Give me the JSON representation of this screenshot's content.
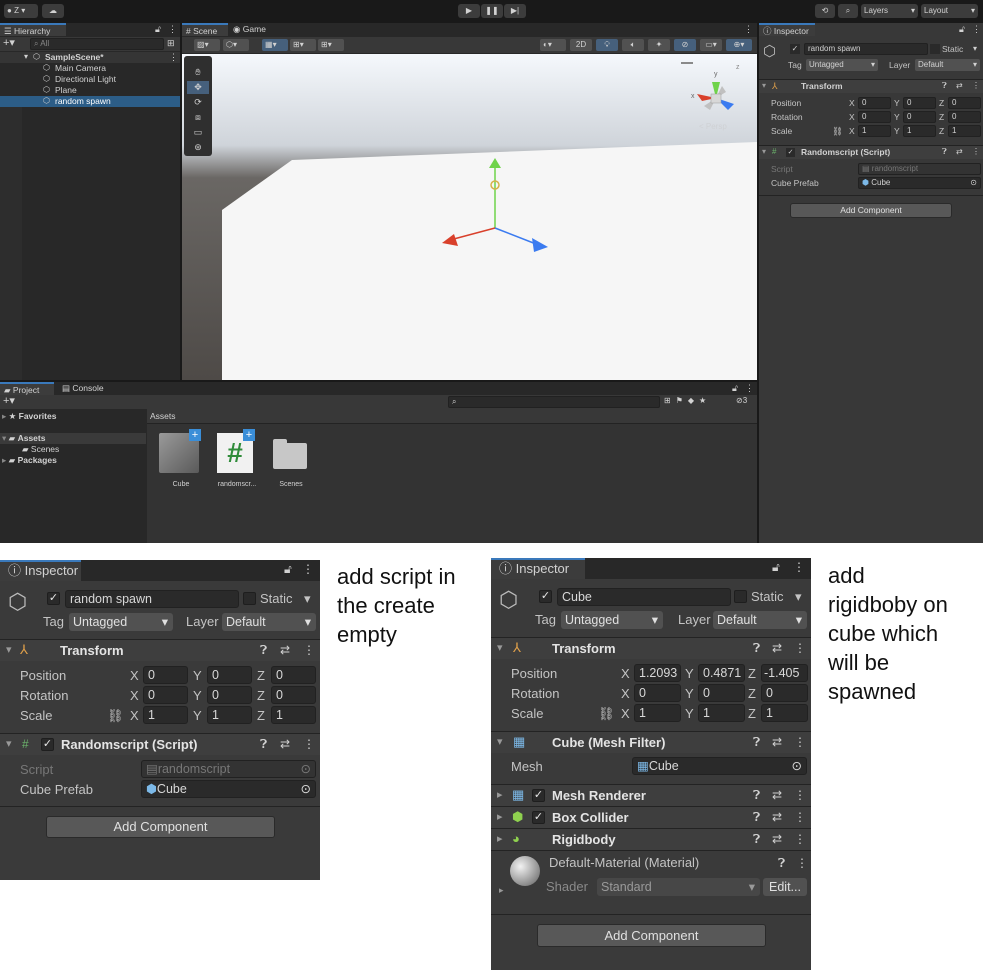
{
  "toolbar": {
    "account_label": "Z",
    "layers_label": "Layers",
    "layout_label": "Layout"
  },
  "hierarchy": {
    "tab_label": "Hierarchy",
    "search_placeholder": "All",
    "scene_name": "SampleScene*",
    "items": [
      "Main Camera",
      "Directional Light",
      "Plane",
      "random spawn"
    ]
  },
  "scene_view": {
    "tab_scene": "Scene",
    "tab_game": "Game",
    "btn_2d": "2D",
    "persp_label": "< Persp",
    "gizmo_axes": {
      "x": "x",
      "y": "y",
      "z": "z"
    }
  },
  "inspector_top": {
    "tab_label": "Inspector",
    "object_name": "random spawn",
    "static_label": "Static",
    "tag_label": "Tag",
    "tag_value": "Untagged",
    "layer_label": "Layer",
    "layer_value": "Default",
    "transform_title": "Transform",
    "position_label": "Position",
    "rotation_label": "Rotation",
    "scale_label": "Scale",
    "position": {
      "x": "0",
      "y": "0",
      "z": "0"
    },
    "rotation": {
      "x": "0",
      "y": "0",
      "z": "0"
    },
    "scale": {
      "x": "1",
      "y": "1",
      "z": "1"
    },
    "script_title": "Randomscript (Script)",
    "script_label": "Script",
    "script_value": "randomscript",
    "prefab_label": "Cube Prefab",
    "prefab_value": "Cube",
    "add_component": "Add Component",
    "axis_x": "X",
    "axis_y": "Y",
    "axis_z": "Z"
  },
  "project": {
    "tab_project": "Project",
    "tab_console": "Console",
    "favorites_label": "Favorites",
    "assets_label": "Assets",
    "scenes_label": "Scenes",
    "packages_label": "Packages",
    "assets_header": "Assets",
    "hidden_count": "3",
    "assets": [
      {
        "name": "Cube",
        "icon": "cube-prefab-icon"
      },
      {
        "name": "randomscr...",
        "icon": "csharp-script-icon"
      },
      {
        "name": "Scenes",
        "icon": "folder-icon"
      }
    ]
  },
  "inspector_left": {
    "tab_label": "Inspector",
    "object_name": "random spawn",
    "static_label": "Static",
    "tag_label": "Tag",
    "tag_value": "Untagged",
    "layer_label": "Layer",
    "layer_value": "Default",
    "transform_title": "Transform",
    "position_label": "Position",
    "rotation_label": "Rotation",
    "scale_label": "Scale",
    "position": {
      "x": "0",
      "y": "0",
      "z": "0"
    },
    "rotation": {
      "x": "0",
      "y": "0",
      "z": "0"
    },
    "scale": {
      "x": "1",
      "y": "1",
      "z": "1"
    },
    "script_title": "Randomscript (Script)",
    "script_label": "Script",
    "script_value": "randomscript",
    "prefab_label": "Cube Prefab",
    "prefab_value": "Cube",
    "add_component": "Add Component",
    "axis_x": "X",
    "axis_y": "Y",
    "axis_z": "Z"
  },
  "note_left": "add script in\nthe create\nempty",
  "inspector_right": {
    "tab_label": "Inspector",
    "object_name": "Cube",
    "static_label": "Static",
    "tag_label": "Tag",
    "tag_value": "Untagged",
    "layer_label": "Layer",
    "layer_value": "Default",
    "transform_title": "Transform",
    "position_label": "Position",
    "rotation_label": "Rotation",
    "scale_label": "Scale",
    "position": {
      "x": "1.2093",
      "y": "0.4871",
      "z": "-1.405"
    },
    "rotation": {
      "x": "0",
      "y": "0",
      "z": "0"
    },
    "scale": {
      "x": "1",
      "y": "1",
      "z": "1"
    },
    "mesh_filter_title": "Cube (Mesh Filter)",
    "mesh_label": "Mesh",
    "mesh_value": "Cube",
    "mesh_renderer_title": "Mesh Renderer",
    "box_collider_title": "Box Collider",
    "rigidbody_title": "Rigidbody",
    "material_title": "Default-Material (Material)",
    "shader_label": "Shader",
    "shader_value": "Standard",
    "edit_label": "Edit...",
    "add_component": "Add Component",
    "axis_x": "X",
    "axis_y": "Y",
    "axis_z": "Z"
  },
  "note_right": "add\nrigidboby on\ncube which\nwill be\nspawned",
  "colors": {
    "editor_bg": "#191919",
    "panel_bg": "#383838",
    "selection": "#2c5d87",
    "accent_tab": "#3a79bb"
  }
}
